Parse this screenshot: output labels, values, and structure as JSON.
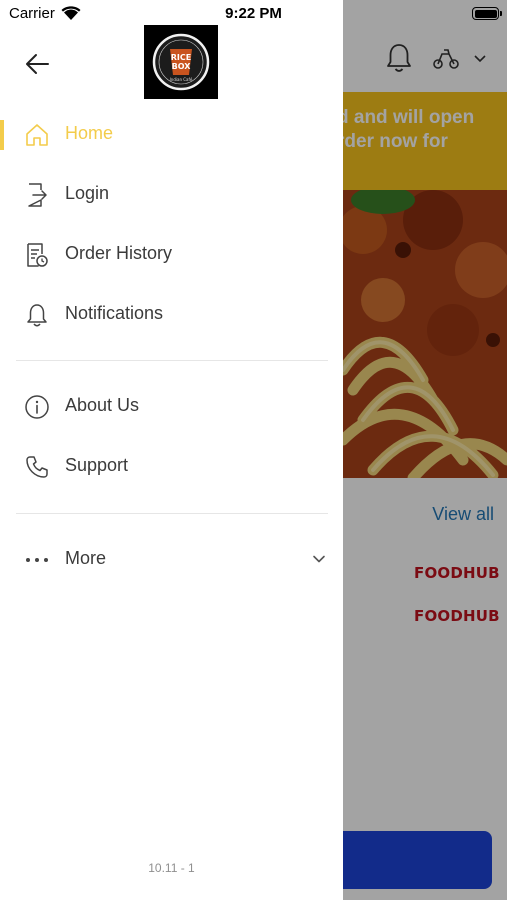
{
  "status_bar": {
    "carrier": "Carrier",
    "time": "9:22 PM"
  },
  "drawer": {
    "back_icon": "arrow-left-icon",
    "logo_text": {
      "line1": "RICE",
      "line2": "BOX",
      "tagline": "Indian Café"
    },
    "items": [
      {
        "label": "Home",
        "icon": "home-icon",
        "active": true
      },
      {
        "label": "Login",
        "icon": "login-icon",
        "active": false
      },
      {
        "label": "Order History",
        "icon": "order-history-icon",
        "active": false
      },
      {
        "label": "Notifications",
        "icon": "bell-icon",
        "active": false
      },
      {
        "label": "About Us",
        "icon": "info-icon",
        "active": false
      },
      {
        "label": "Support",
        "icon": "phone-icon",
        "active": false
      },
      {
        "label": "More",
        "icon": "more-dots-icon",
        "active": false
      }
    ],
    "version": "10.11 - 1",
    "accent_color": "#f3cc4b"
  },
  "background_app": {
    "banner_text_line1": "d and will open",
    "banner_text_line2": "rder now for",
    "view_all": "View all",
    "brand_1": "FOODHUB",
    "brand_2": "FOODHUB",
    "banner_color": "#f6c21d",
    "link_color": "#2477b6",
    "button_color": "#1d44d8"
  }
}
